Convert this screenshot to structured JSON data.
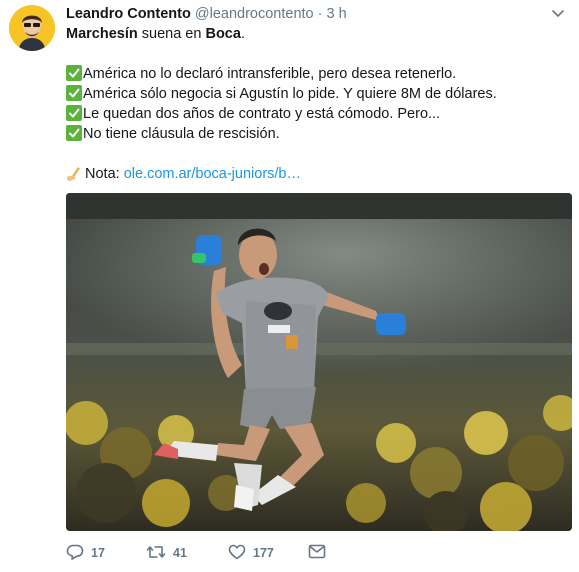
{
  "tweet": {
    "author_name": "Leandro Contento",
    "handle": "@leandrocontento",
    "separator": "·",
    "time": "3 h",
    "headline": {
      "name_a": "Marchesín",
      "middle": " suena en ",
      "name_b": "Boca",
      "end": "."
    },
    "bullets": [
      "América no lo declaró intransferible, pero desea retenerlo.",
      "América sólo negocia si Agustín lo pide. Y quiere 8M de dólares.",
      "Le quedan dos años de contrato y está cómodo. Pero...",
      "No tiene cláusula de rescisión."
    ],
    "note_label": "Nota: ",
    "note_link": "ole.com.ar/boca-juniors/b…"
  },
  "actions": {
    "replies": "17",
    "retweets": "41",
    "likes": "177"
  },
  "icons": [
    "avatar",
    "caret-down-icon",
    "checkmark-icon",
    "writing-hand-icon",
    "reply-icon",
    "retweet-icon",
    "like-icon",
    "message-icon"
  ],
  "colors": {
    "link": "#1b95e0",
    "check": "#5ab43b",
    "muted": "#657786",
    "kit": "#9a9ea3",
    "gloves": "#2a7fd8"
  }
}
